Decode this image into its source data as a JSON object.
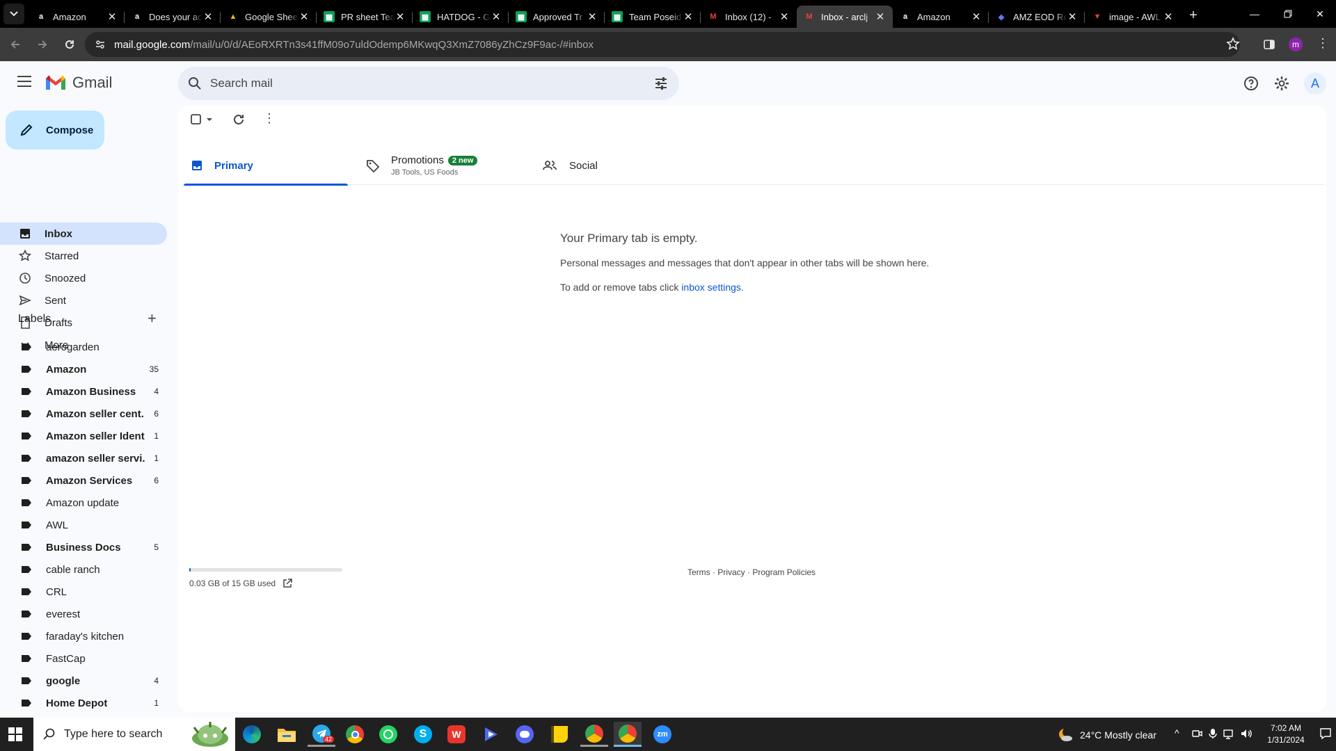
{
  "browser": {
    "tabs": [
      {
        "title": "Amazon",
        "icon": "amazon-icon"
      },
      {
        "title": "Does your ac",
        "icon": "amazon-icon"
      },
      {
        "title": "Google Shee",
        "icon": "google-drive-icon"
      },
      {
        "title": "PR sheet Tea",
        "icon": "google-sheets-icon"
      },
      {
        "title": "HATDOG - G",
        "icon": "google-sheets-icon"
      },
      {
        "title": "Approved Tr",
        "icon": "google-sheets-icon"
      },
      {
        "title": "Team Poseid",
        "icon": "google-sheets-icon"
      },
      {
        "title": "Inbox (12) - ",
        "icon": "gmail-icon"
      },
      {
        "title": "Inbox - arclj",
        "icon": "gmail-icon"
      },
      {
        "title": "Amazon",
        "icon": "amazon-icon"
      },
      {
        "title": "AMZ EOD Re",
        "icon": "notion-icon"
      },
      {
        "title": "image - AWL",
        "icon": "gmail-red-icon"
      }
    ],
    "url_host": "mail.google.com",
    "url_path": "/mail/u/0/d/AEoRXRTn3s41ffM09o7uldOdemp6MKwqQ3XmZ7086yZhCz9F9ac-/#inbox",
    "profile_initial": "m"
  },
  "gmail": {
    "brand": "Gmail",
    "search_placeholder": "Search mail",
    "compose_label": "Compose",
    "account_initial": "A",
    "nav": [
      {
        "label": "Inbox",
        "icon": "inbox-icon"
      },
      {
        "label": "Starred",
        "icon": "star-icon"
      },
      {
        "label": "Snoozed",
        "icon": "clock-icon"
      },
      {
        "label": "Sent",
        "icon": "send-icon"
      },
      {
        "label": "Drafts",
        "icon": "draft-icon"
      },
      {
        "label": "More",
        "icon": "chevron-down-icon"
      }
    ],
    "labels_title": "Labels",
    "labels": [
      {
        "name": "aerogarden",
        "count": ""
      },
      {
        "name": "Amazon",
        "count": "35"
      },
      {
        "name": "Amazon Business",
        "count": "4"
      },
      {
        "name": "Amazon seller cent...",
        "count": "6"
      },
      {
        "name": "Amazon seller Ident",
        "count": "1"
      },
      {
        "name": "amazon seller servi...",
        "count": "1"
      },
      {
        "name": "Amazon Services",
        "count": "6"
      },
      {
        "name": "Amazon update",
        "count": ""
      },
      {
        "name": "AWL",
        "count": ""
      },
      {
        "name": "Business Docs",
        "count": "5"
      },
      {
        "name": "cable ranch",
        "count": ""
      },
      {
        "name": "CRL",
        "count": ""
      },
      {
        "name": "everest",
        "count": ""
      },
      {
        "name": "faraday's kitchen",
        "count": ""
      },
      {
        "name": "FastCap",
        "count": ""
      },
      {
        "name": "google",
        "count": "4"
      },
      {
        "name": "Home Depot",
        "count": "1"
      }
    ],
    "inbox_tabs": {
      "primary": "Primary",
      "promotions": "Promotions",
      "promotions_badge": "2 new",
      "promotions_sub": "JB Tools, US Foods",
      "social": "Social"
    },
    "empty": {
      "title": "Your Primary tab is empty.",
      "line1": "Personal messages and messages that don't appear in other tabs will be shown here.",
      "line2_prefix": "To add or remove tabs click ",
      "line2_link": "inbox settings",
      "line2_suffix": "."
    },
    "footer": {
      "storage": "0.03 GB of 15 GB used",
      "storage_fraction": 0.002,
      "terms": "Terms",
      "privacy": "Privacy",
      "policies": "Program Policies",
      "sep": " · "
    }
  },
  "taskbar": {
    "search_placeholder": "Type here to search",
    "weather": "24°C  Mostly clear",
    "time": "7:02 AM",
    "date": "1/31/2024",
    "telegram_badge": "42"
  }
}
